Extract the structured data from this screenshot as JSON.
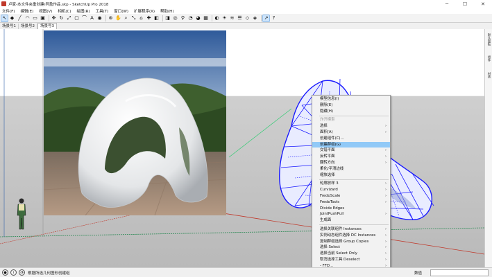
{
  "window": {
    "title": "卢家-本文件夹重创建/异盈作品.skp - SketchUp Pro 2018",
    "buttons": {
      "minimize": "─",
      "maximize": "☐",
      "close": "✕"
    }
  },
  "menubar": [
    "文件(F)",
    "编辑(E)",
    "视图(V)",
    "相机(C)",
    "绘图(R)",
    "工具(T)",
    "窗口(W)",
    "扩展程序(X)",
    "帮助(H)"
  ],
  "toolbar": {
    "tools": [
      {
        "name": "select-tool",
        "glyph": "↖",
        "selected": true
      },
      {
        "name": "eraser-tool",
        "glyph": "◆"
      },
      {
        "name": "line-tool",
        "glyph": "╱"
      },
      {
        "name": "arc-tool",
        "glyph": "◠"
      },
      {
        "name": "shape-tool",
        "glyph": "▭"
      },
      {
        "name": "pushpull-tool",
        "glyph": "▣"
      },
      {
        "name": "move-tool",
        "glyph": "✥"
      },
      {
        "name": "rotate-tool",
        "glyph": "↻"
      },
      {
        "name": "scale-tool",
        "glyph": "⤢"
      },
      {
        "name": "offset-tool",
        "glyph": "▢"
      },
      {
        "name": "tape-tool",
        "glyph": "⌒"
      },
      {
        "name": "text-tool",
        "glyph": "A"
      },
      {
        "name": "paint-tool",
        "glyph": "◉"
      },
      {
        "name": "orbit-tool",
        "glyph": "⊛"
      },
      {
        "name": "pan-tool",
        "glyph": "✋"
      },
      {
        "name": "zoom-tool",
        "glyph": "⌕"
      },
      {
        "name": "zoom-extents-tool",
        "glyph": "⤡"
      },
      {
        "name": "warehouse-tool",
        "glyph": "⌂"
      },
      {
        "name": "extension-tool",
        "glyph": "✚"
      },
      {
        "name": "section-tool",
        "glyph": "◧"
      },
      {
        "name": "xray-tool",
        "glyph": "◨"
      },
      {
        "name": "camera-tool",
        "glyph": "◎"
      },
      {
        "name": "walk-tool",
        "glyph": "⚲"
      },
      {
        "name": "lookaround-tool",
        "glyph": "◔"
      },
      {
        "name": "solid-tool",
        "glyph": "◕"
      },
      {
        "name": "sandbox-tool",
        "glyph": "▦"
      },
      {
        "name": "style-tool",
        "glyph": "◐"
      },
      {
        "name": "shadow-tool",
        "glyph": "☀"
      },
      {
        "name": "fog-tool",
        "glyph": "≋"
      },
      {
        "name": "layer-tool",
        "glyph": "☰"
      },
      {
        "name": "plugin-a-tool",
        "glyph": "◇"
      },
      {
        "name": "plugin-b-tool",
        "glyph": "◈"
      },
      {
        "name": "cursor-highlight-tool",
        "glyph": "↗",
        "selected": true
      },
      {
        "name": "help-tool",
        "glyph": "?"
      }
    ]
  },
  "scene_tabs": [
    "场景号1",
    "场景号2",
    "场景号3"
  ],
  "active_tab": 2,
  "context_menu": {
    "items": [
      {
        "label": "模型信息(I)"
      },
      {
        "label": "删除(E)"
      },
      {
        "label": "隐藏(H)"
      },
      {
        "sep": true
      },
      {
        "label": "炸开模型",
        "disabled": true
      },
      {
        "label": "选择",
        "submenu": true
      },
      {
        "label": "面积(A)",
        "submenu": true
      },
      {
        "label": "创建组件(C)..."
      },
      {
        "label": "创建群组(G)",
        "highlight": true
      },
      {
        "label": "交错平面",
        "submenu": true
      },
      {
        "label": "反转平面",
        "submenu": true
      },
      {
        "label": "翻转方向",
        "submenu": true
      },
      {
        "label": "柔化/平滑边线"
      },
      {
        "label": "缩放选择"
      },
      {
        "sep": true
      },
      {
        "label": "轮廓放样 3",
        "submenu": true
      },
      {
        "label": "Curvizard",
        "submenu": true
      },
      {
        "label": "FredoScale",
        "submenu": true
      },
      {
        "label": "FredoTools",
        "submenu": true
      },
      {
        "label": "Divide Edges"
      },
      {
        "label": "JointPushPull",
        "submenu": true
      },
      {
        "label": "生成面"
      },
      {
        "sep": true
      },
      {
        "label": "选择关联组件 Instances",
        "submenu": true
      },
      {
        "label": "实例动态组件选择 DC Instances",
        "submenu": true
      },
      {
        "label": "复制群组选择 Group Copies",
        "submenu": true
      },
      {
        "label": "选择 Select",
        "submenu": true
      },
      {
        "label": "选择当前 Select Only",
        "submenu": true
      },
      {
        "label": "取消选择工具 Deselect",
        "submenu": true
      },
      {
        "label": "- FFD...",
        "submenu": true
      }
    ]
  },
  "right_panel": [
    "默认面板",
    "组件",
    "材质"
  ],
  "status": {
    "hint": "根据所选几何图形创建组",
    "measure_label": "数值",
    "measure_value": ""
  },
  "colors": {
    "selection_blue": "#1a1aff",
    "menu_highlight": "#91c9f7",
    "axis_red": "#c0392b",
    "axis_green": "#2ecc71"
  }
}
